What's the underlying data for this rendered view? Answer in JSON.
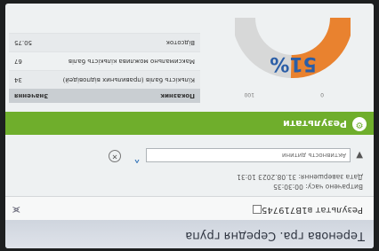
{
  "header": {
    "title": "Теренова гра. Середня група"
  },
  "result": {
    "label": "Результат в1В719745",
    "share_icon": "share-icon"
  },
  "meta": {
    "time_label": "Витрачено часу:",
    "time_value": "00:30:35",
    "date_label": "Дата завершення:",
    "date_value": "31.08.2023 10:31"
  },
  "filter": {
    "placeholder": "Активность дитини"
  },
  "results_bar": {
    "title": "Результати"
  },
  "gauge": {
    "percent_label": "51%",
    "min_label": "0",
    "max_label": "100",
    "value": 51
  },
  "table": {
    "columns": [
      "Показник",
      "Значення"
    ],
    "rows": [
      [
        "Кількість балів (правильних відповідей)",
        "34"
      ],
      [
        "Максимально можлива кількість балів",
        "67"
      ],
      [
        "Відсоток",
        "50.75"
      ]
    ]
  },
  "colors": {
    "accent": "#6fae2c",
    "gauge_fill": "#e9822f",
    "gauge_track": "#d7d8d8",
    "link": "#2b6fb6"
  }
}
